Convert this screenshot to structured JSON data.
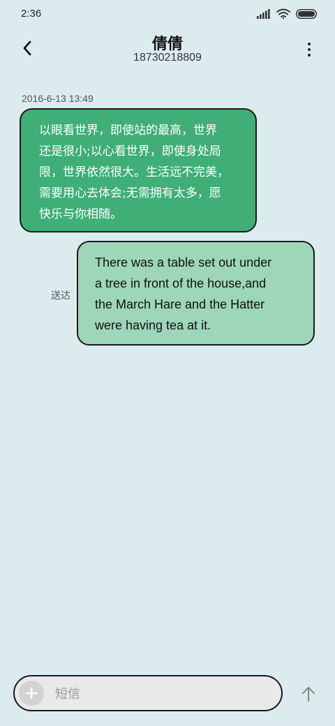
{
  "status_bar": {
    "time": "2:36"
  },
  "header": {
    "contact_name": "倩倩",
    "contact_number": "18730218809"
  },
  "conversation": {
    "timestamp": "2016-6-13 13:49",
    "incoming_lines": [
      "以眼看世界，即使站的最高，世界",
      "还是很小;以心看世界，即使身处局",
      "限，世界依然很大。生活远不完美，",
      "需要用心去体会;无需拥有太多，愿",
      "快乐与你相随。"
    ],
    "outgoing_lines": [
      "There was a table set out under",
      "a tree in front of the house,and",
      "the March Hare and the Hatter",
      "were having tea at it."
    ],
    "delivery_status": "送达"
  },
  "composer": {
    "placeholder": "短信",
    "value": ""
  },
  "icons": {
    "back": "back-arrow-icon",
    "more": "more-vert-icon",
    "add": "plus-icon",
    "send": "send-arrow-icon",
    "signal": "signal-icon",
    "wifi": "wifi-icon",
    "battery": "battery-icon"
  },
  "colors": {
    "background": "#dcebee",
    "incoming_bubble": "#3fae77",
    "outgoing_bubble": "#9ed6b9"
  }
}
